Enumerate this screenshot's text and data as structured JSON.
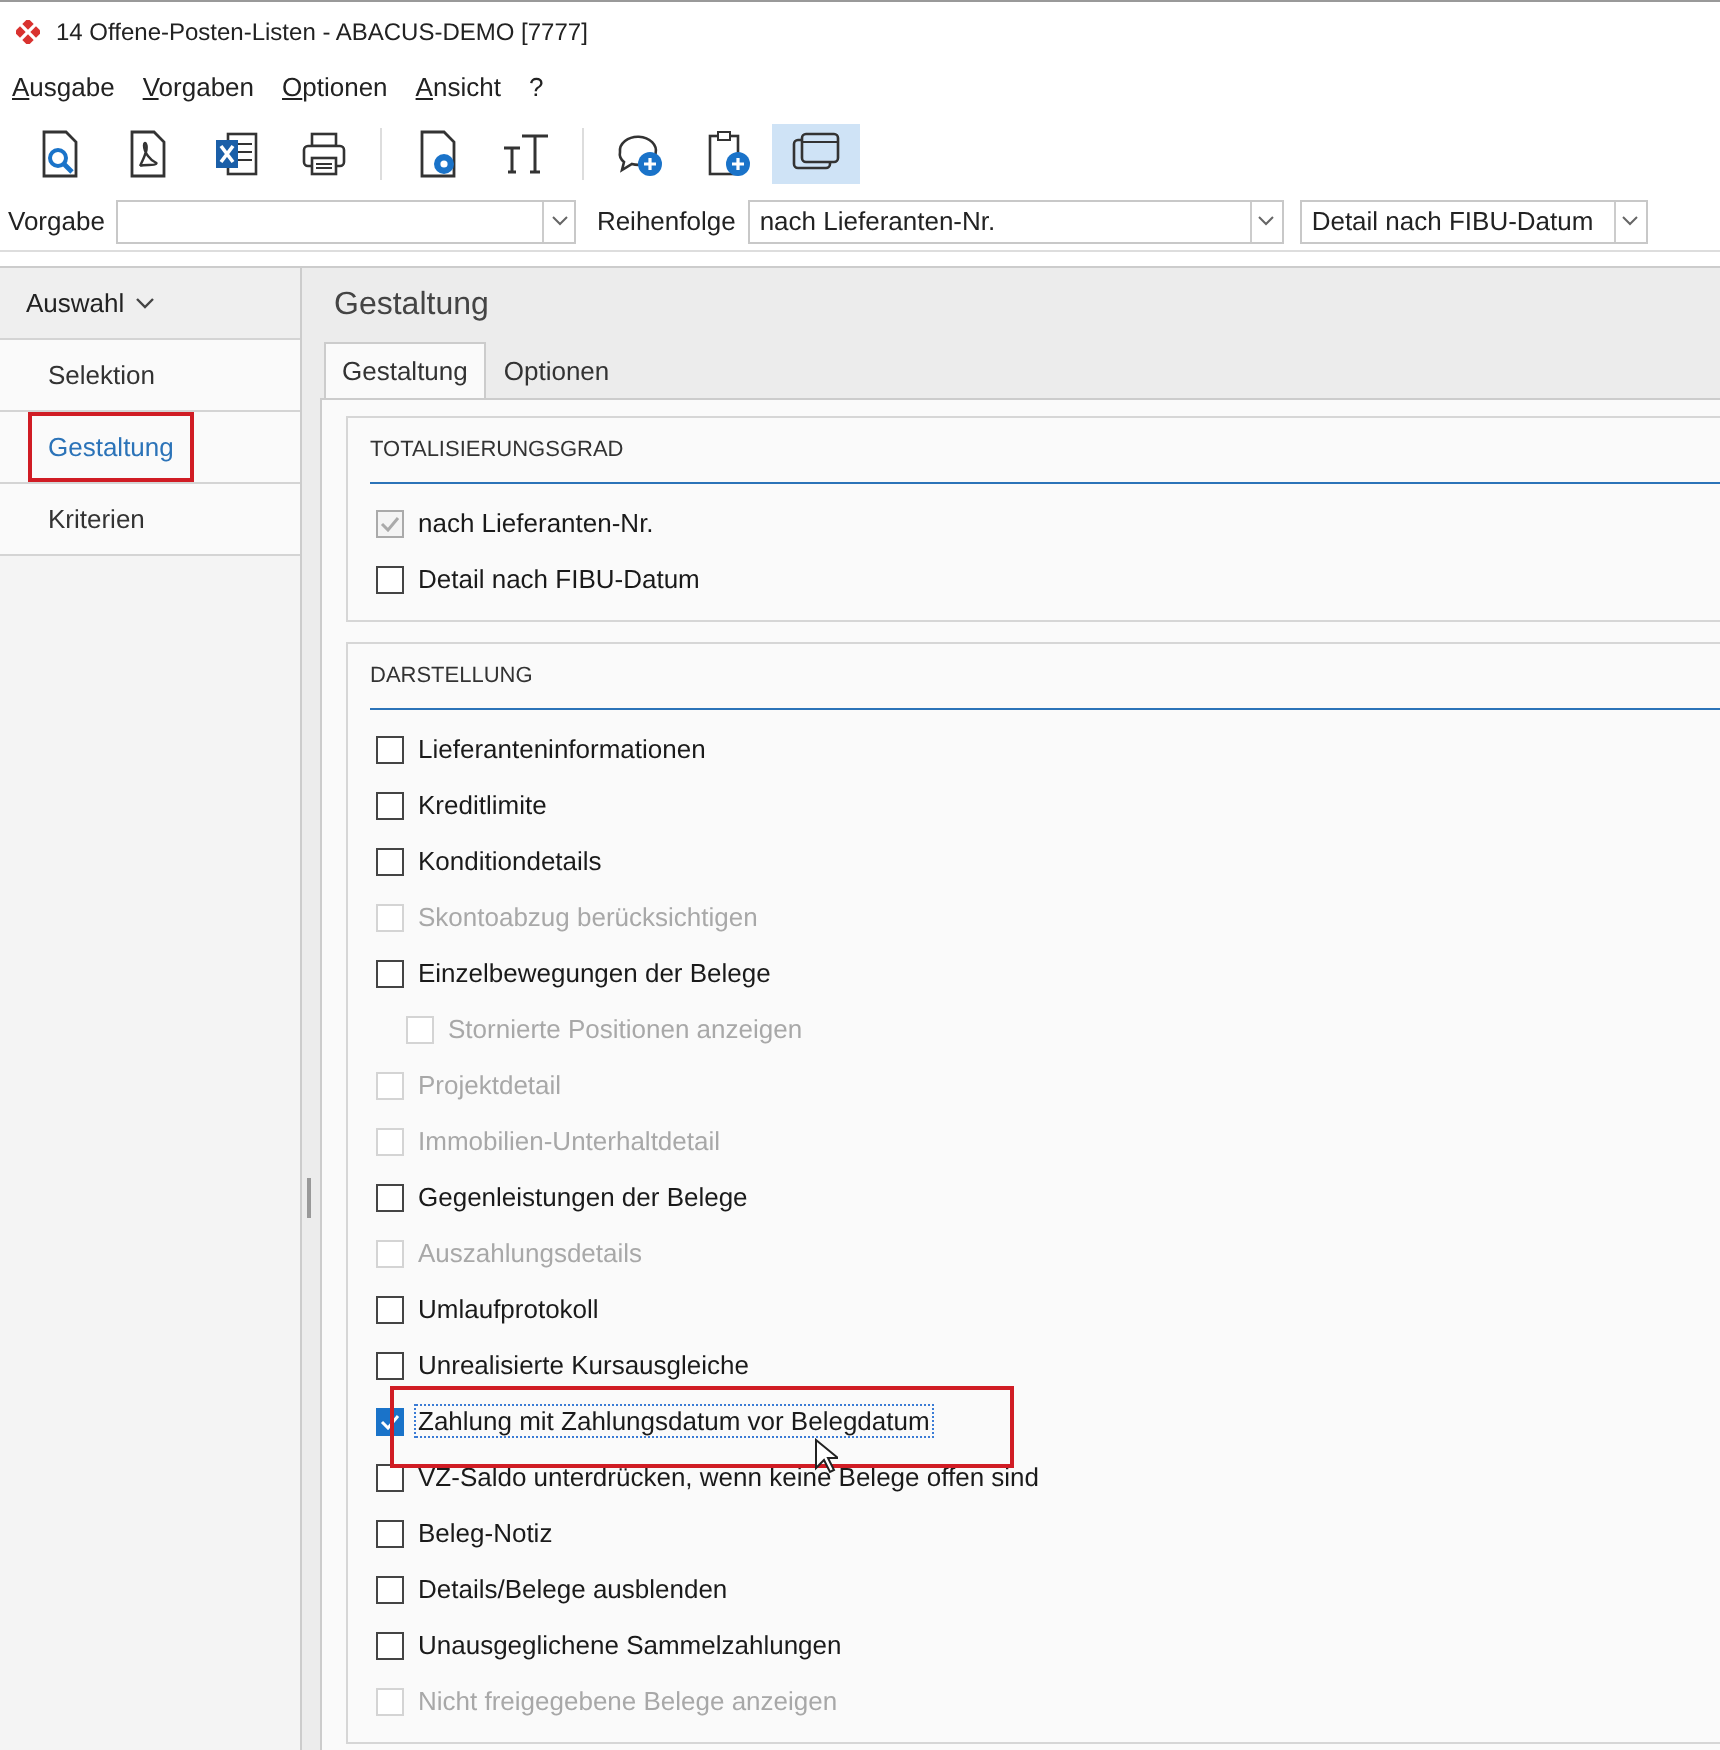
{
  "window": {
    "title": "14 Offene-Posten-Listen - ABACUS-DEMO [7777]"
  },
  "menu": [
    "Ausgabe",
    "Vorgaben",
    "Optionen",
    "Ansicht",
    "?"
  ],
  "toolbar_groups": [
    {
      "buttons": [
        {
          "kind": "preview",
          "selected": false
        },
        {
          "kind": "pdf",
          "selected": false
        },
        {
          "kind": "excel",
          "selected": false
        },
        {
          "kind": "print",
          "selected": false
        }
      ]
    },
    {
      "buttons": [
        {
          "kind": "doc-settings",
          "selected": false
        },
        {
          "kind": "text-size",
          "selected": false
        }
      ]
    },
    {
      "buttons": [
        {
          "kind": "comment-add",
          "selected": false
        },
        {
          "kind": "clipboard-add",
          "selected": false
        },
        {
          "kind": "windows",
          "selected": true
        }
      ]
    }
  ],
  "filters": [
    {
      "label": "Vorgabe"
    },
    {
      "label": "Reihenfolge",
      "value": "nach Lieferanten-Nr."
    },
    {
      "value": "Detail nach FIBU-Datum"
    }
  ],
  "sidebar": {
    "header": "Auswahl",
    "expanded": true,
    "items": [
      {
        "label": "Selektion",
        "selected": false,
        "highlighted": false
      },
      {
        "label": "Gestaltung",
        "selected": true,
        "highlighted": true
      },
      {
        "label": "Kriterien",
        "selected": false,
        "highlighted": false
      }
    ]
  },
  "page_title": "Gestaltung",
  "tabs": [
    {
      "label": "Gestaltung",
      "selected": true
    },
    {
      "label": "Optionen",
      "selected": false
    }
  ],
  "sections": [
    {
      "title": "TOTALISIERUNGSGRAD",
      "options": [
        {
          "label": "nach Lieferanten-Nr.",
          "checked": true,
          "readonly": true
        },
        {
          "label": "Detail nach FIBU-Datum",
          "checked": false,
          "readonly": false
        }
      ]
    },
    {
      "title": "DARSTELLUNG",
      "options": [
        {
          "label": "Lieferanteninformationen",
          "checked": false,
          "disabled": false
        },
        {
          "label": "Kreditlimite",
          "checked": false,
          "disabled": false
        },
        {
          "label": "Konditiondetails",
          "checked": false,
          "disabled": false
        },
        {
          "label": "Skontoabzug berücksichtigen",
          "checked": false,
          "disabled": true
        },
        {
          "label": "Einzelbewegungen der Belege",
          "checked": false,
          "disabled": false,
          "children": [
            {
              "label": "Stornierte Positionen anzeigen",
              "checked": false,
              "disabled": true
            }
          ]
        },
        {
          "label": "Projektdetail",
          "checked": false,
          "disabled": true
        },
        {
          "label": "Immobilien-Unterhaltdetail",
          "checked": false,
          "disabled": true
        },
        {
          "label": "Gegenleistungen der Belege",
          "checked": false,
          "disabled": false
        },
        {
          "label": "Auszahlungsdetails",
          "checked": false,
          "disabled": true
        },
        {
          "label": "Umlaufprotokoll",
          "checked": false,
          "disabled": false
        },
        {
          "label": "Unrealisierte Kursausgleiche",
          "checked": false,
          "disabled": false
        },
        {
          "label": "Zahlung mit Zahlungsdatum vor Belegdatum",
          "checked": true,
          "disabled": false,
          "focused": true,
          "highlighted": true
        },
        {
          "label": "VZ-Saldo unterdrücken, wenn keine Belege offen sind",
          "checked": false,
          "disabled": false
        },
        {
          "label": "Beleg-Notiz",
          "checked": false,
          "disabled": false
        },
        {
          "label": "Details/Belege ausblenden",
          "checked": false,
          "disabled": false
        },
        {
          "label": "Unausgeglichene Sammelzahlungen",
          "checked": false,
          "disabled": false
        },
        {
          "label": "Nicht freigegebene Belege anzeigen",
          "checked": false,
          "disabled": true
        }
      ]
    }
  ]
}
